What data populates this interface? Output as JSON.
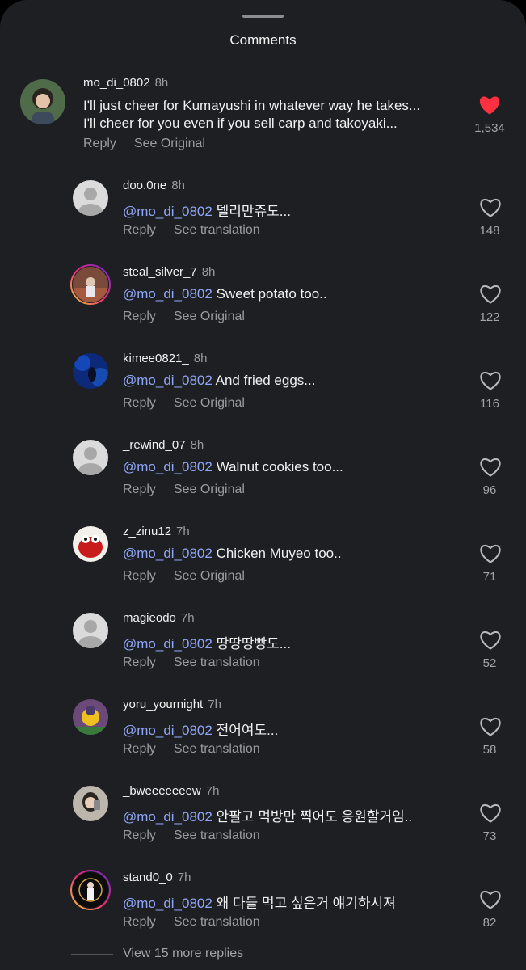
{
  "header": {
    "title": "Comments"
  },
  "top_comment": {
    "username": "mo_di_0802",
    "time": "8h",
    "line1": "I'll just cheer for Kumayushi in whatever way he takes...",
    "line2": "I'll cheer for you even if you sell carp and takoyaki...",
    "reply_label": "Reply",
    "secondary_label": "See Original",
    "likes": "1,534",
    "liked": true
  },
  "replies": [
    {
      "username": "doo.0ne",
      "time": "8h",
      "mention": "@mo_di_0802",
      "text": "델리만쥬도...",
      "reply_label": "Reply",
      "secondary_label": "See translation",
      "likes": "148"
    },
    {
      "username": "steal_silver_7",
      "time": "8h",
      "mention": "@mo_di_0802",
      "text": "Sweet potato too..",
      "reply_label": "Reply",
      "secondary_label": "See Original",
      "likes": "122"
    },
    {
      "username": "kimee0821_",
      "time": "8h",
      "mention": "@mo_di_0802",
      "text": "And fried eggs...",
      "reply_label": "Reply",
      "secondary_label": "See Original",
      "likes": "116"
    },
    {
      "username": "_rewind_07",
      "time": "8h",
      "mention": "@mo_di_0802",
      "text": "Walnut cookies too...",
      "reply_label": "Reply",
      "secondary_label": "See Original",
      "likes": "96"
    },
    {
      "username": "z_zinu12",
      "time": "7h",
      "mention": "@mo_di_0802",
      "text": "Chicken Muyeo too..",
      "reply_label": "Reply",
      "secondary_label": "See Original",
      "likes": "71"
    },
    {
      "username": "magieodo",
      "time": "7h",
      "mention": "@mo_di_0802",
      "text": "땅땅땅빵도...",
      "reply_label": "Reply",
      "secondary_label": "See translation",
      "likes": "52"
    },
    {
      "username": "yoru_yournight",
      "time": "7h",
      "mention": "@mo_di_0802",
      "text": "전어여도...",
      "reply_label": "Reply",
      "secondary_label": "See translation",
      "likes": "58"
    },
    {
      "username": "_bweeeeeeew",
      "time": "7h",
      "mention": "@mo_di_0802",
      "text": "안팔고 먹방만 찍어도 응원할거임..",
      "reply_label": "Reply",
      "secondary_label": "See translation",
      "likes": "73"
    },
    {
      "username": "stand0_0",
      "time": "7h",
      "mention": "@mo_di_0802",
      "text": "왜 다들 먹고 싶은거 얘기하시져",
      "reply_label": "Reply",
      "secondary_label": "See translation",
      "likes": "82"
    }
  ],
  "view_more_label": "View 15 more replies",
  "colors": {
    "background": "#1e1f23",
    "mention": "#8ea6f7",
    "liked_heart": "#ff3040"
  }
}
